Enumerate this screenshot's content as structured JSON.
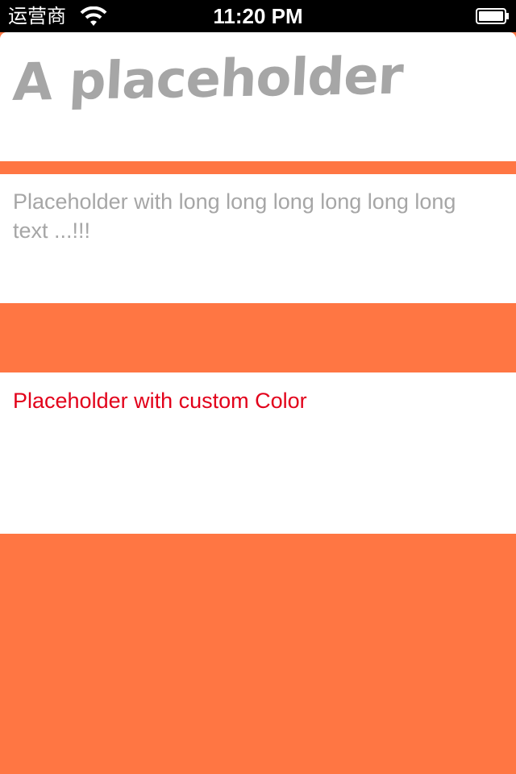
{
  "status_bar": {
    "carrier": "运营商",
    "time": "11:20 PM",
    "wifi_icon": "wifi-icon",
    "battery_icon": "battery-icon"
  },
  "fields": [
    {
      "placeholder": "A placeholder"
    },
    {
      "placeholder": "Placeholder with long long long long long long text ...!!!"
    },
    {
      "placeholder": "Placeholder with custom Color",
      "placeholder_color": "#e2001a"
    }
  ],
  "colors": {
    "background": "#ff7643",
    "field_background": "#ffffff",
    "placeholder_gray": "#a6a6a6"
  }
}
